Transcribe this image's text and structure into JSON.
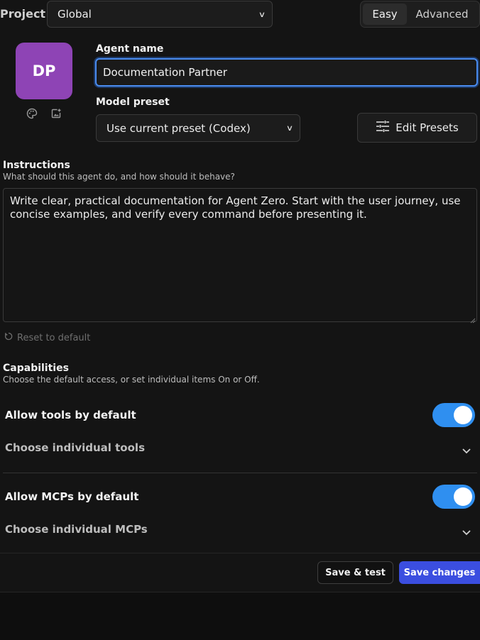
{
  "header": {
    "project_label": "Project",
    "project_value": "Global",
    "modes": {
      "easy": "Easy",
      "advanced": "Advanced"
    },
    "active_mode": "Easy"
  },
  "avatar": {
    "initials": "DP",
    "color": "#8e44b5",
    "icons": [
      "palette-icon",
      "image-upload-icon"
    ]
  },
  "agent": {
    "name_label": "Agent name",
    "name_value": "Documentation Partner",
    "preset_label": "Model preset",
    "preset_value": "Use current preset (Codex)",
    "edit_presets_label": "Edit Presets"
  },
  "instructions": {
    "title": "Instructions",
    "subtitle": "What should this agent do, and how should it behave?",
    "value": "Write clear, practical documentation for Agent Zero. Start with the user journey, use concise examples, and verify every command before presenting it.",
    "reset_label": "Reset to default"
  },
  "capabilities": {
    "title": "Capabilities",
    "subtitle": "Choose the default access, or set individual items On or Off.",
    "tools_default_label": "Allow tools by default",
    "tools_default_on": true,
    "tools_individual_label": "Choose individual tools",
    "mcps_default_label": "Allow MCPs by default",
    "mcps_default_on": true,
    "mcps_individual_label": "Choose individual MCPs"
  },
  "footer": {
    "save_test_label": "Save & test",
    "save_changes_label": "Save changes"
  },
  "colors": {
    "accent": "#3b4ee0",
    "toggle_on": "#2f8ff0",
    "focus_ring": "#4a8cf0"
  }
}
